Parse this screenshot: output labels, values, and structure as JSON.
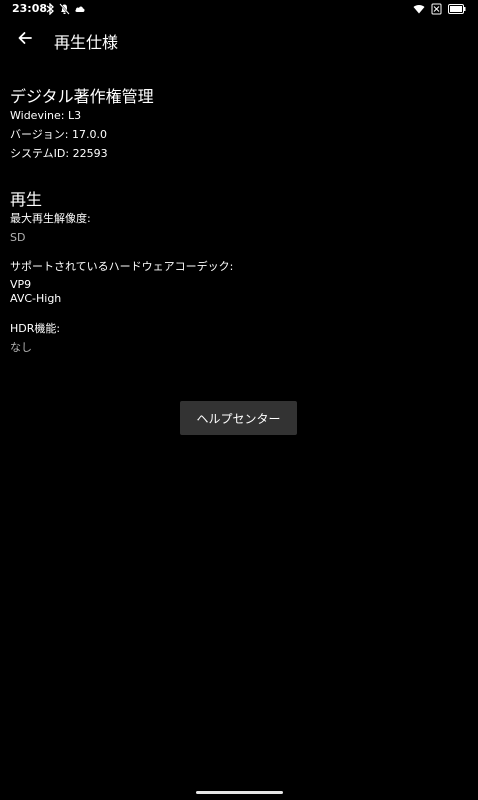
{
  "status_bar": {
    "time": "23:08",
    "icons_left": [
      "bluetooth-icon",
      "mute-icon",
      "cloud-icon"
    ],
    "icons_right": [
      "wifi-icon",
      "no-sim-icon",
      "battery-icon"
    ]
  },
  "app_bar": {
    "title": "再生仕様",
    "back_icon": "arrow-left-icon"
  },
  "drm": {
    "heading": "デジタル著作権管理",
    "widevine": "Widevine: L3",
    "version": "バージョン: 17.0.0",
    "system_id": "システムID: 22593"
  },
  "playback": {
    "heading": "再生",
    "max_resolution_label": "最大再生解像度:",
    "max_resolution_value": "SD",
    "codecs_label": "サポートされているハードウェアコーデック:",
    "codecs": [
      "VP9",
      "AVC-High"
    ],
    "hdr_label": "HDR機能:",
    "hdr_value": "なし"
  },
  "help_button": {
    "label": "ヘルプセンター"
  },
  "colors": {
    "background": "#000000",
    "text_primary": "#ffffff",
    "text_secondary": "#b3b3b3",
    "button_bg": "#333333"
  }
}
